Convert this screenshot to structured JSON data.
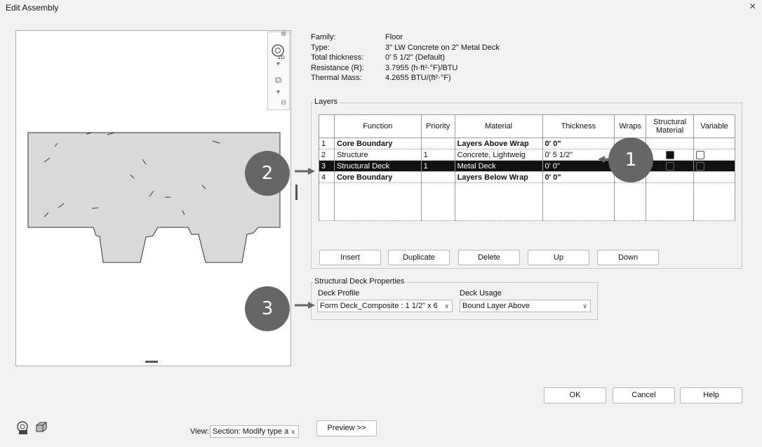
{
  "window": {
    "title": "Edit Assembly",
    "close": "×"
  },
  "props": [
    {
      "k": "Family:",
      "v": "Floor"
    },
    {
      "k": "Type:",
      "v": "3\" LW Concrete on 2\" Metal Deck"
    },
    {
      "k": "Total thickness:",
      "v": "0'  5 1/2\" (Default)"
    },
    {
      "k": "Resistance (R):",
      "v": "3.7955 (h·ft²·°F)/BTU"
    },
    {
      "k": "Thermal Mass:",
      "v": "4.2655 BTU/(ft²·°F)"
    }
  ],
  "layers": {
    "legend": "Layers",
    "headers": [
      "Function",
      "Priority",
      "Material",
      "Thickness",
      "Wraps",
      "Structural Material",
      "Variable"
    ],
    "rows": [
      {
        "n": "1",
        "function": "Core Boundary",
        "priority": "",
        "material": "Layers Above Wrap",
        "thickness": "0'  0\"",
        "bold": true,
        "selected": false
      },
      {
        "n": "2",
        "function": "Structure",
        "priority": "1",
        "material": "Concrete, Lightweig",
        "thickness": "0'  5 1/2\"",
        "bold": false,
        "selected": false
      },
      {
        "n": "3",
        "function": "Structural Deck",
        "priority": "1",
        "material": "Metal Deck",
        "thickness": "0'  0\"",
        "bold": false,
        "selected": true
      },
      {
        "n": "4",
        "function": "Core Boundary",
        "priority": "",
        "material": "Layers Below Wrap",
        "thickness": "0'  0\"",
        "bold": true,
        "selected": false
      }
    ]
  },
  "buttons": {
    "insert": "Insert",
    "duplicate": "Duplicate",
    "delete": "Delete",
    "up": "Up",
    "down": "Down",
    "ok": "OK",
    "cancel": "Cancel",
    "help": "Help",
    "preview": "Preview >>"
  },
  "deck": {
    "legend": "Structural Deck Properties",
    "profile_label": "Deck Profile",
    "profile_value": "Form Deck_Composite : 1 1/2\" x 6",
    "usage_label": "Deck Usage",
    "usage_value": "Bound Layer Above"
  },
  "view": {
    "label": "View:",
    "value": "Section: Modify type a"
  },
  "callouts": [
    "1",
    "2",
    "3"
  ]
}
